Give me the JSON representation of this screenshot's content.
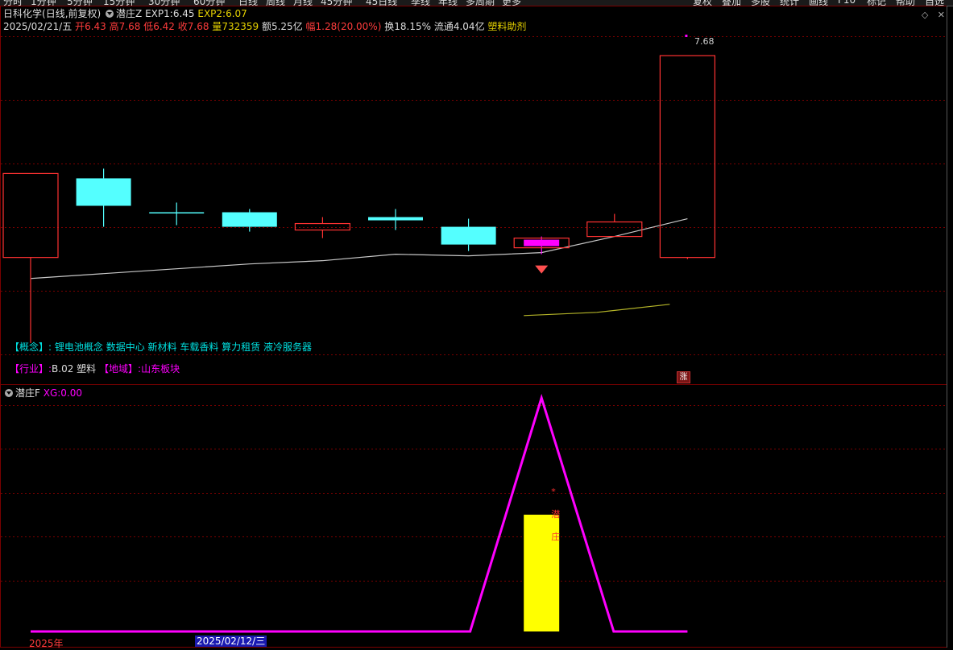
{
  "toolbar": {
    "left_items": [
      "分时",
      "1分钟",
      "5分钟",
      "15分钟",
      "30分钟",
      "60分钟",
      "日线",
      "周线",
      "月线",
      "45分钟",
      "45日线",
      "季线",
      "年线",
      "多周期",
      "更多"
    ],
    "right_items": [
      "复权",
      "叠加",
      "多股",
      "统计",
      "画线",
      "F10",
      "标记",
      "帮助",
      "自选"
    ]
  },
  "header": {
    "stock_name": "日科化学",
    "period": "(日线,前复权)",
    "indicator_name": "潜庄Z",
    "exp1_label": "EXP1:",
    "exp1_value": "6.45",
    "exp2_label": "EXP2:",
    "exp2_value": "6.07"
  },
  "quote": {
    "date": "2025/02/21/五",
    "open_label": "开",
    "open": "6.43",
    "high_label": "高",
    "high": "7.68",
    "low_label": "低",
    "low": "6.42",
    "close_label": "收",
    "close": "7.68",
    "volume_label": "量",
    "volume": "732359",
    "amount_label": "额",
    "amount": "5.25亿",
    "change_label": "幅",
    "change": "1.28(20.00%)",
    "turnover_label": "换",
    "turnover": "18.15%",
    "float_label": "流通",
    "float": "4.04亿",
    "sector": "塑料助剂"
  },
  "window_controls": {
    "diamond": "◇",
    "close": "✕"
  },
  "concept": {
    "label": "【概念】:",
    "value": "锂电池概念 数据中心 新材料 车载香料 算力租赁 液冷服务器"
  },
  "industry": {
    "label": "【行业】:",
    "value": "B.02 塑料",
    "region_label": "【地域】:",
    "region_value": "山东板块"
  },
  "high_marker": "7.68",
  "zhang_badge": "涨",
  "sub_panel": {
    "indicator_name": "潜庄F",
    "xg_label": "XG:",
    "xg_value": "0.00",
    "signal_chars": [
      "*",
      "潜",
      "庄"
    ]
  },
  "x_axis": {
    "year_label": "2025年",
    "cursor_date": "2025/02/12/三"
  },
  "colors": {
    "background": "#000000",
    "up_candle": "#ff3232",
    "down_candle": "#54ffff",
    "signal_candle": "#ff00ff",
    "ma_exp1": "#c8c8c8",
    "ma_exp2": "#b4b428",
    "sub_line": "#ff00ff",
    "sub_bar": "#ffff00",
    "grid": "#7a0000"
  },
  "chart_data": [
    {
      "type": "candlestick",
      "title": "潜庄Z",
      "ylim": [
        5.7,
        7.8
      ],
      "candles": [
        {
          "open": 6.43,
          "high": 6.95,
          "low": 5.9,
          "close": 6.95,
          "dir": "up"
        },
        {
          "open": 6.92,
          "high": 6.98,
          "low": 6.62,
          "close": 6.75,
          "dir": "down"
        },
        {
          "open": 6.71,
          "high": 6.77,
          "low": 6.63,
          "close": 6.71,
          "dir": "doji"
        },
        {
          "open": 6.71,
          "high": 6.73,
          "low": 6.59,
          "close": 6.62,
          "dir": "down"
        },
        {
          "open": 6.6,
          "high": 6.68,
          "low": 6.55,
          "close": 6.64,
          "dir": "up"
        },
        {
          "open": 6.68,
          "high": 6.73,
          "low": 6.6,
          "close": 6.66,
          "dir": "down"
        },
        {
          "open": 6.62,
          "high": 6.67,
          "low": 6.47,
          "close": 6.51,
          "dir": "down"
        },
        {
          "open": 6.54,
          "high": 6.56,
          "low": 6.45,
          "close": 6.5,
          "dir": "signal"
        },
        {
          "open": 6.56,
          "high": 6.7,
          "low": 6.56,
          "close": 6.65,
          "dir": "up"
        },
        {
          "open": 6.43,
          "high": 7.68,
          "low": 6.42,
          "close": 7.68,
          "dir": "up"
        }
      ],
      "series": [
        {
          "name": "EXP1",
          "values": [
            6.3,
            6.33,
            6.36,
            6.39,
            6.41,
            6.45,
            6.44,
            6.46,
            6.56,
            6.67
          ]
        },
        {
          "name": "EXP2",
          "values": [
            null,
            null,
            null,
            null,
            null,
            null,
            null,
            6.07,
            6.09,
            6.14
          ]
        }
      ],
      "signal_marker_index": 7
    },
    {
      "type": "line",
      "title": "潜庄F",
      "ylim": [
        0,
        100
      ],
      "series": [
        {
          "name": "line",
          "values": [
            0,
            0,
            0,
            0,
            0,
            0,
            0,
            100,
            0,
            0
          ]
        },
        {
          "name": "bar",
          "values": [
            0,
            0,
            0,
            0,
            0,
            0,
            0,
            50,
            0,
            0
          ]
        }
      ],
      "series_start_index": 0
    }
  ]
}
